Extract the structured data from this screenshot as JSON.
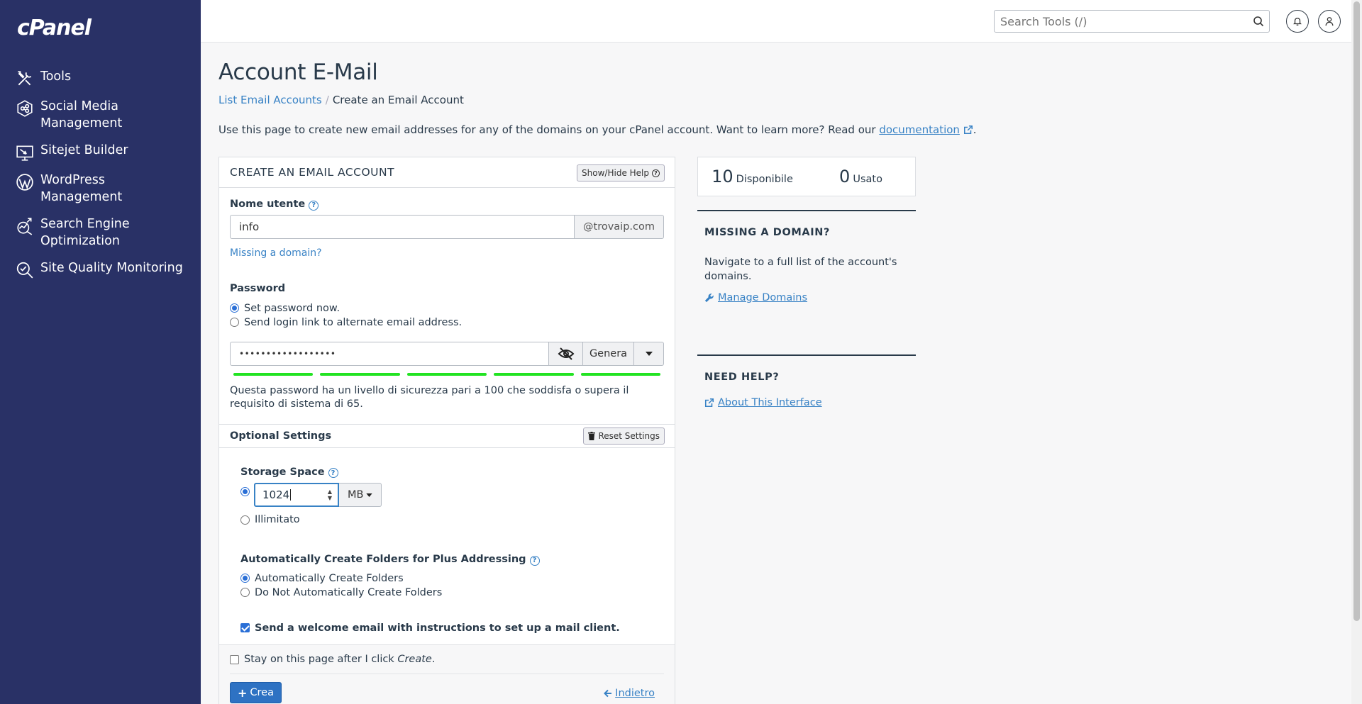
{
  "app": {
    "logo": "cPanel"
  },
  "sidebar": {
    "items": [
      {
        "label": "Tools",
        "icon": "tools-icon"
      },
      {
        "label": "Social Media Management",
        "icon": "social-media-icon"
      },
      {
        "label": "Sitejet Builder",
        "icon": "sitejet-icon"
      },
      {
        "label": "WordPress Management",
        "icon": "wordpress-icon"
      },
      {
        "label": "Search Engine Optimization",
        "icon": "seo-icon"
      },
      {
        "label": "Site Quality Monitoring",
        "icon": "site-quality-icon"
      }
    ]
  },
  "topbar": {
    "search_placeholder": "Search Tools (/)"
  },
  "page": {
    "title": "Account E-Mail",
    "breadcrumb": {
      "parent": "List Email Accounts",
      "current": "Create an Email Account"
    },
    "intro_text": "Use this page to create new email addresses for any of the domains on your cPanel account. Want to learn more? Read our ",
    "intro_link": "documentation",
    "intro_end": "."
  },
  "form": {
    "heading": "CREATE AN EMAIL ACCOUNT",
    "help_button": "Show/Hide Help",
    "username_label": "Nome utente",
    "username_value": "info",
    "domain_suffix": "@trovaip.com",
    "missing_domain_link": "Missing a domain?",
    "password_label": "Password",
    "password_options": [
      "Set password now.",
      "Send login link to alternate email address."
    ],
    "password_value": "••••••••••••••••••",
    "generate_button": "Genera",
    "strength_segments": 5,
    "strength_text": "Questa password ha un livello di sicurezza pari a 100 che soddisfa o supera il requisito di sistema di 65.",
    "optional_heading": "Optional Settings",
    "reset_button": "Reset Settings",
    "storage_label": "Storage Space",
    "storage_value": "1024",
    "storage_unit": "MB",
    "storage_unlimited": "Illimitato",
    "plus_folders_label": "Automatically Create Folders for Plus Addressing",
    "plus_folders_options": [
      "Automatically Create Folders",
      "Do Not Automatically Create Folders"
    ],
    "welcome_email": "Send a welcome email with instructions to set up a mail client.",
    "stay_on_page_prefix": "Stay on this page after I click ",
    "stay_on_page_em": "Create",
    "stay_on_page_suffix": ".",
    "create_button": "Crea",
    "back_link": "Indietro"
  },
  "stats": {
    "available_num": "10",
    "available_label": "Disponibile",
    "used_num": "0",
    "used_label": "Usato"
  },
  "missing_domain_box": {
    "title": "MISSING A DOMAIN?",
    "text": "Navigate to a full list of the account's domains.",
    "link": "Manage Domains"
  },
  "help_box": {
    "title": "NEED HELP?",
    "link": "About This Interface"
  },
  "colors": {
    "sidebar_bg": "#293166",
    "link": "#3882c5",
    "strength": "#22e322",
    "primary": "#2e72c3"
  }
}
